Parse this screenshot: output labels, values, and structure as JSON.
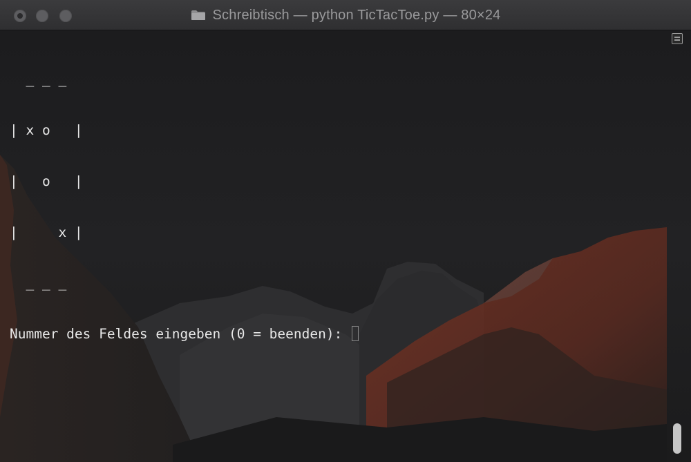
{
  "window": {
    "title": "Schreibtisch — python TicTacToe.py — 80×24"
  },
  "terminal": {
    "lines": [
      "  _ _ _",
      "| x o   |",
      "|   o   |",
      "|     x |",
      "  _ _ _"
    ],
    "prompt": "Nummer des Feldes eingeben (0 = beenden): "
  },
  "colors": {
    "titlebar": "#333335",
    "terminal_bg": "#1d1d1f",
    "text": "#e8e8e8",
    "mountain_glow": "#b5503a"
  },
  "icons": {
    "title_icon": "folder-icon",
    "scroll_button": "split-pane-icon"
  }
}
